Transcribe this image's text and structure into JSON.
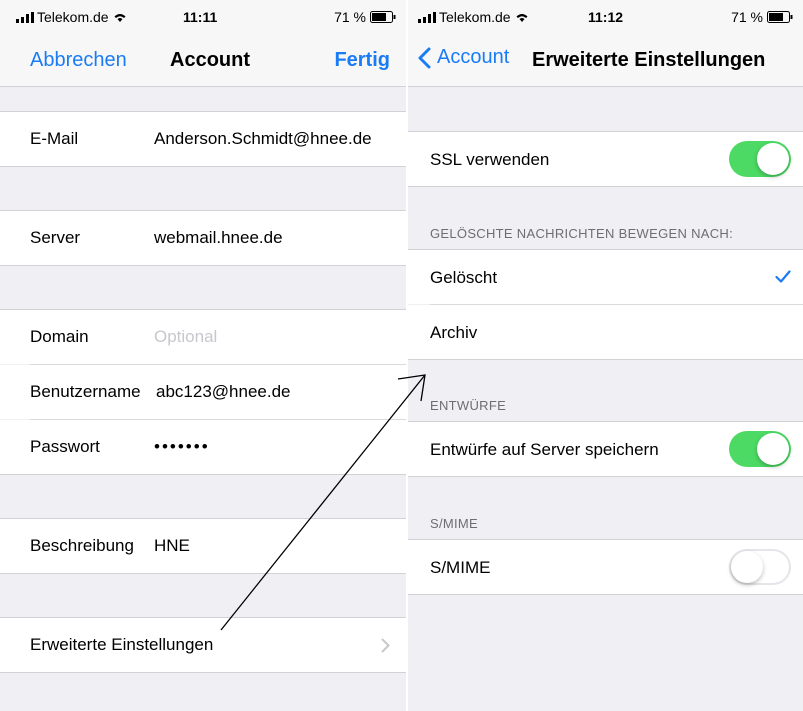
{
  "left": {
    "status": {
      "carrier": "Telekom.de",
      "time": "11:11",
      "battery": "71 %"
    },
    "nav": {
      "cancel": "Abbrechen",
      "title": "Account",
      "done": "Fertig"
    },
    "fields": {
      "email": {
        "label": "E-Mail",
        "value": "Anderson.Schmidt@hnee.de"
      },
      "server": {
        "label": "Server",
        "value": "webmail.hnee.de"
      },
      "domain": {
        "label": "Domain",
        "placeholder": "Optional"
      },
      "username": {
        "label": "Benutzername",
        "value": "abc123@hnee.de"
      },
      "password": {
        "label": "Passwort",
        "value": "•••••••"
      },
      "description": {
        "label": "Beschreibung",
        "value": "HNE"
      }
    },
    "advanced": {
      "label": "Erweiterte Einstellungen"
    }
  },
  "right": {
    "status": {
      "carrier": "Telekom.de",
      "time": "11:12",
      "battery": "71 %"
    },
    "nav": {
      "back": "Account",
      "title": "Erweiterte Einstellungen"
    },
    "ssl": {
      "label": "SSL verwenden",
      "on": true
    },
    "deleted_section": {
      "header": "GELÖSCHTE NACHRICHTEN BEWEGEN NACH:",
      "options": [
        "Gelöscht",
        "Archiv"
      ],
      "selected": "Gelöscht"
    },
    "drafts_section": {
      "header": "ENTWÜRFE",
      "label": "Entwürfe auf Server speichern",
      "on": true
    },
    "smime_section": {
      "header": "S/MIME",
      "label": "S/MIME",
      "on": false
    }
  },
  "colors": {
    "accent": "#1a7cf5",
    "toggle_on": "#4cd964",
    "background": "#efeff4"
  }
}
